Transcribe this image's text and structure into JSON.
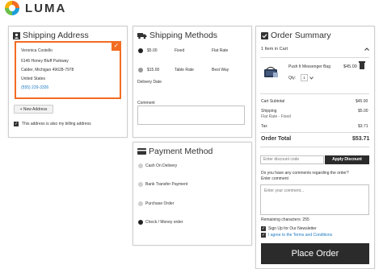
{
  "brand": {
    "name": "LUMA"
  },
  "shipping_address": {
    "title": "Shipping Address",
    "address": {
      "name": "Veronica Costello",
      "street": "6146 Honey Bluff Parkway",
      "city_line": "Calder, Michigan 49628-7978",
      "country": "United States",
      "phone": "(555) 229-3326"
    },
    "new_address_button": "+ New Address",
    "billing_same_label": "This address is also my billing address",
    "billing_same_checked": true,
    "accent_color": "#f26c21"
  },
  "shipping_methods": {
    "title": "Shipping Methods",
    "methods": [
      {
        "price": "$5.00",
        "method": "Fixed",
        "carrier": "Flat Rate",
        "selected": true
      },
      {
        "price": "$15.00",
        "method": "Table Rate",
        "carrier": "Best Way",
        "selected": false
      }
    ],
    "delivery_date_label": "Delivery Date",
    "comment_label": "Comment"
  },
  "payment_method": {
    "title": "Payment Method",
    "options": [
      {
        "label": "Cash On Delivery",
        "selected": false
      },
      {
        "label": "Bank Transfer Payment",
        "selected": false
      },
      {
        "label": "Purchase Order",
        "selected": false
      },
      {
        "label": "Check / Money order",
        "selected": true
      }
    ]
  },
  "order_summary": {
    "title": "Order Summary",
    "items_in_cart": "1 Item in Cart",
    "item": {
      "name": "Push It Messenger Bag",
      "price": "$45.00",
      "qty_label": "Qty:",
      "qty": "1"
    },
    "totals": {
      "cart_subtotal_label": "Cart Subtotal",
      "cart_subtotal": "$45.00",
      "shipping_label": "Shipping",
      "shipping_sub": "Flat Rate - Fixed",
      "shipping": "$5.00",
      "tax_label": "Tax",
      "tax": "$3.71",
      "order_total_label": "Order Total",
      "order_total": "$53.71"
    },
    "discount_placeholder": "Enter discount code",
    "apply_discount_button": "Apply Discount",
    "comments_question": "Do you have any comments regarding the order?",
    "comment_label": "Enter comment",
    "comment_placeholder": "Enter your comment...",
    "remaining_chars": "Remaining characters: 255",
    "newsletter_label": "Sign Up for Our Newsletter",
    "terms_label": "I agree to the Terms and Conditions",
    "place_order_button": "Place Order"
  }
}
